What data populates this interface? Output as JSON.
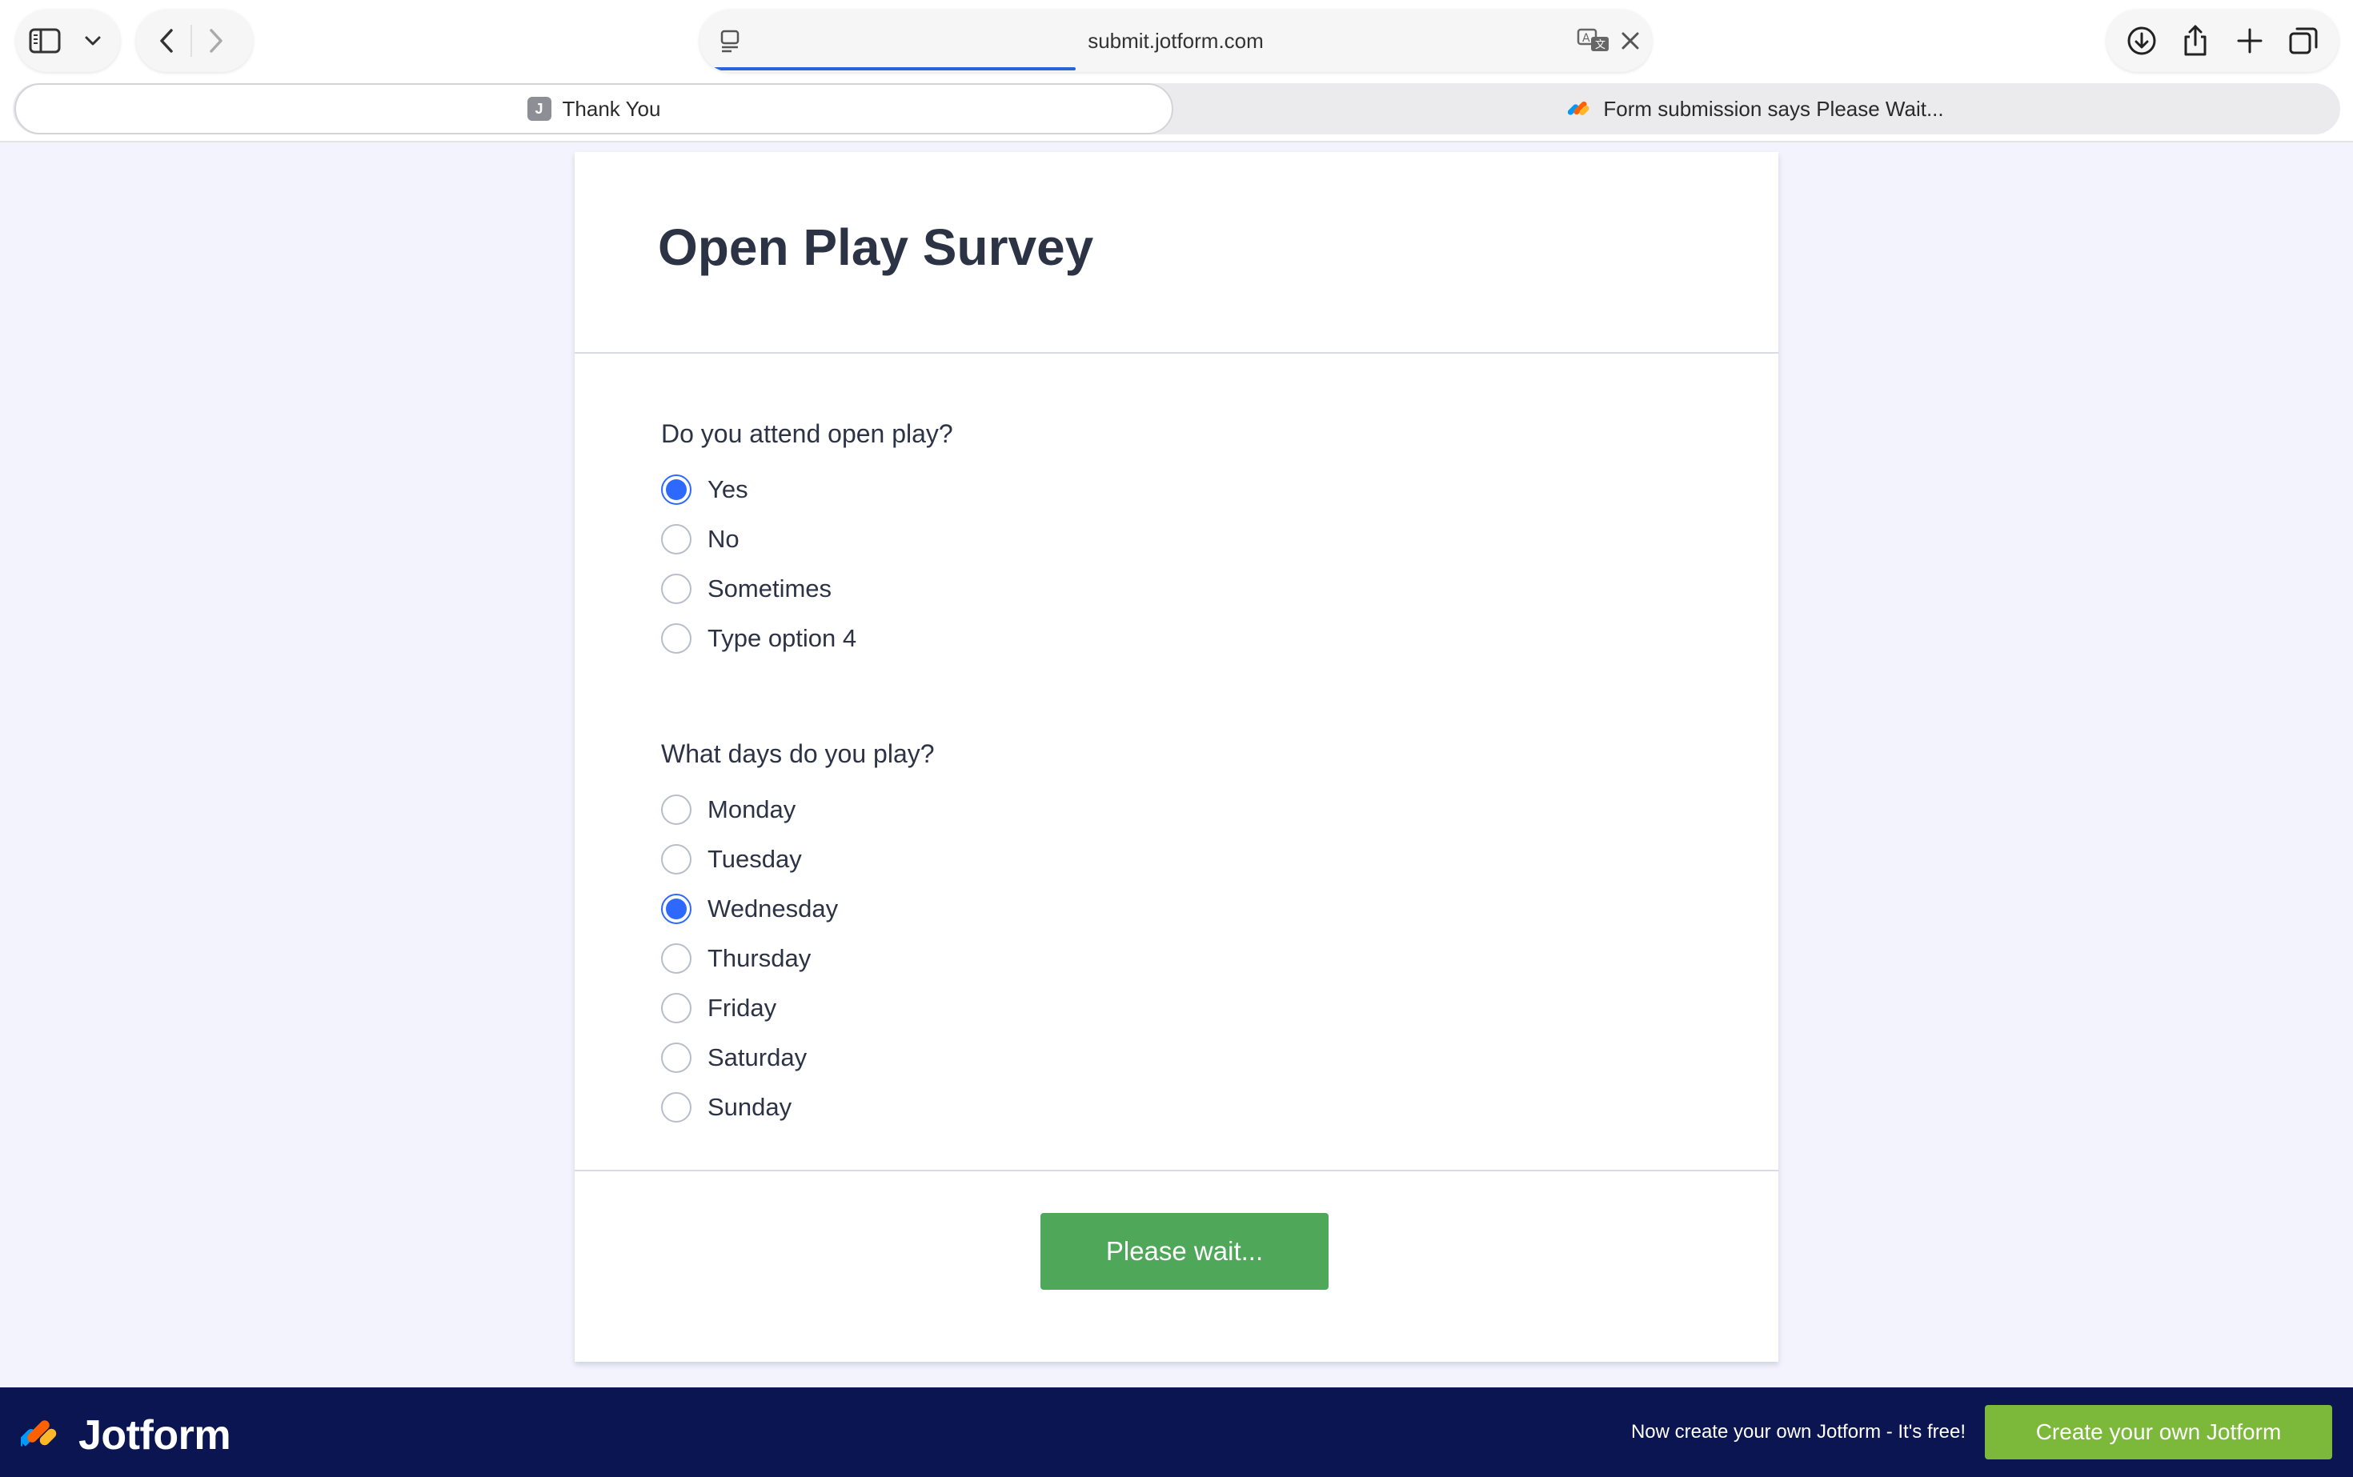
{
  "browser": {
    "url": "submit.jotform.com",
    "load_progress_percent": 38,
    "icons": {
      "sidebar": "sidebar-icon",
      "chevron": "chevron-down-icon",
      "back": "back-icon",
      "forward": "forward-icon",
      "reader": "reader-icon",
      "translate": "translate-icon",
      "stop": "close-icon",
      "download": "download-icon",
      "share": "share-icon",
      "new_tab": "plus-icon",
      "tabs": "tab-overview-icon"
    },
    "tabs": [
      {
        "favicon_letter": "J",
        "title": "Thank You",
        "active": true
      },
      {
        "title": "Form submission says Please Wait...",
        "active": false
      }
    ]
  },
  "form": {
    "title": "Open Play Survey",
    "questions": [
      {
        "label": "Do you attend open play?",
        "options": [
          {
            "label": "Yes",
            "checked": true
          },
          {
            "label": "No",
            "checked": false
          },
          {
            "label": "Sometimes",
            "checked": false
          },
          {
            "label": "Type option 4",
            "checked": false
          }
        ]
      },
      {
        "label": "What days do you play?",
        "options": [
          {
            "label": "Monday",
            "checked": false
          },
          {
            "label": "Tuesday",
            "checked": false
          },
          {
            "label": "Wednesday",
            "checked": true
          },
          {
            "label": "Thursday",
            "checked": false
          },
          {
            "label": "Friday",
            "checked": false
          },
          {
            "label": "Saturday",
            "checked": false
          },
          {
            "label": "Sunday",
            "checked": false
          }
        ]
      }
    ],
    "submit_label": "Please wait..."
  },
  "banner": {
    "brand": "Jotform",
    "promo_text": "Now create your own Jotform - It's free!",
    "cta_label": "Create your own Jotform"
  },
  "colors": {
    "radio_checked": "#2e69ff",
    "submit_button": "#4fa85a",
    "banner_bg": "#0a1551",
    "cta_button": "#7cb93a",
    "page_bg": "#f3f3fe"
  }
}
